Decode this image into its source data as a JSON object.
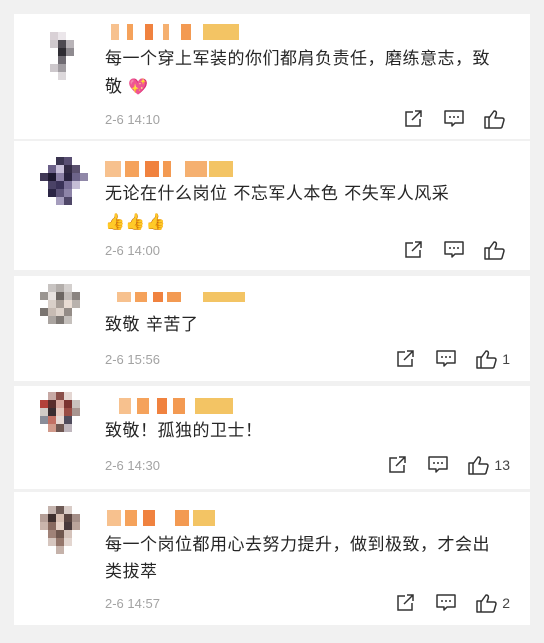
{
  "comments": [
    {
      "text": "每一个穿上军装的你们都肩负责任，磨练意志，致敬",
      "emoji": "💖",
      "time": "2-6 14:10",
      "likes": ""
    },
    {
      "text": "无论在什么岗位 不忘军人本色 不失军人风采",
      "emoji": "👍👍👍",
      "time": "2-6 14:00",
      "likes": ""
    },
    {
      "text": "致敬 辛苦了",
      "emoji": "",
      "time": "2-6 15:56",
      "likes": "1"
    },
    {
      "text": "致敬！孤独的卫士！",
      "emoji": "",
      "time": "2-6 14:30",
      "likes": "13"
    },
    {
      "text": "每一个岗位都用心去努力提升，做到极致，才会出类拔萃",
      "emoji": "",
      "time": "2-6 14:57",
      "likes": "2"
    }
  ],
  "icons": {
    "share": "share-icon",
    "comment": "comment-icon",
    "like": "like-icon"
  },
  "colors": {
    "background": "#f1f1f1",
    "card": "#ffffff",
    "text": "#262626",
    "time": "#a3a3a3",
    "name_blur_orange": "#f5a25b",
    "name_blur_yellow": "#f3c464"
  }
}
